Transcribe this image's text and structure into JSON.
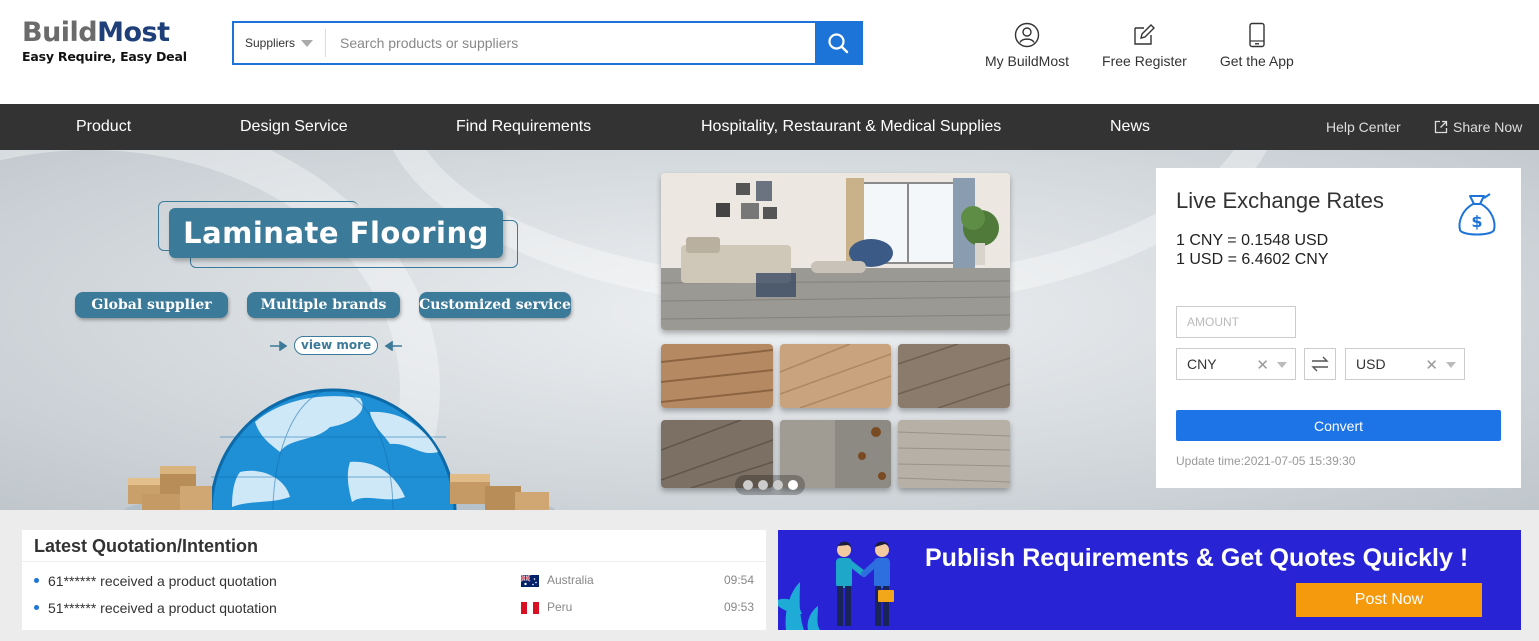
{
  "logo": {
    "part1": "Build",
    "part2": "Most",
    "tagline": "Easy Require, Easy Deal"
  },
  "search": {
    "category": "Suppliers",
    "placeholder": "Search products or suppliers"
  },
  "header_links": [
    {
      "label": "My BuildMost",
      "icon": "user-icon"
    },
    {
      "label": "Free Register",
      "icon": "edit-icon"
    },
    {
      "label": "Get the App",
      "icon": "phone-icon"
    }
  ],
  "nav": {
    "items": [
      "Product",
      "Design Service",
      "Find Requirements",
      "Hospitality, Restaurant & Medical Supplies",
      "News"
    ],
    "help": "Help Center",
    "share": "Share Now"
  },
  "banner": {
    "title": "Laminate Flooring",
    "tags": [
      "Global supplier",
      "Multiple brands",
      "Customized service"
    ],
    "view_more": "view more",
    "slides": 4,
    "active_slide": 4
  },
  "exchange": {
    "title": "Live Exchange Rates",
    "rate1": "1 CNY = 0.1548 USD",
    "rate2": "1 USD = 6.4602 CNY",
    "amount_placeholder": "AMOUNT",
    "from": "CNY",
    "to": "USD",
    "convert_label": "Convert",
    "update": "Update time:2021-07-05 15:39:30"
  },
  "quotations": {
    "title": "Latest Quotation/Intention",
    "rows": [
      {
        "text": "61****** received a product quotation",
        "country": "Australia",
        "time": "09:54"
      },
      {
        "text": "51****** received a product quotation",
        "country": "Peru",
        "time": "09:53"
      }
    ]
  },
  "publish": {
    "title": "Publish Requirements & Get Quotes Quickly !",
    "button": "Post Now"
  },
  "colors": {
    "brand_blue": "#1d74d8",
    "nav_bg": "#333333",
    "banner_teal": "#3c7a99",
    "publish_bg": "#2824d6",
    "post_btn": "#f49a0c"
  }
}
